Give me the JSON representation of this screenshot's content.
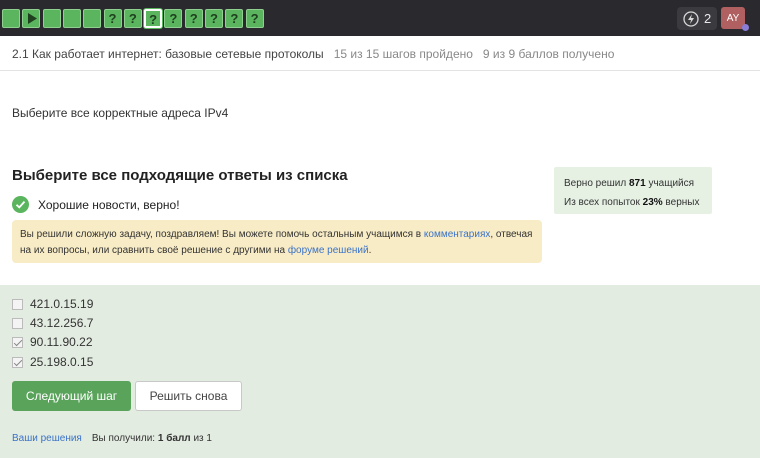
{
  "topbar": {
    "steps": [
      {
        "kind": "square"
      },
      {
        "kind": "play"
      },
      {
        "kind": "square"
      },
      {
        "kind": "square"
      },
      {
        "kind": "square"
      },
      {
        "kind": "question",
        "label": "?"
      },
      {
        "kind": "question",
        "label": "?"
      },
      {
        "kind": "question",
        "label": "?",
        "current": true
      },
      {
        "kind": "question",
        "label": "?"
      },
      {
        "kind": "question",
        "label": "?"
      },
      {
        "kind": "question",
        "label": "?"
      },
      {
        "kind": "question",
        "label": "?"
      },
      {
        "kind": "question",
        "label": "?"
      }
    ],
    "step_color": "#5ab55e",
    "energy_icon": "lightning-icon",
    "energy_count": "2",
    "avatar_initials": "AY"
  },
  "lesson": {
    "title": "2.1 Как работает интернет: базовые сетевые протоколы",
    "steps_done": "15 из 15 шагов пройдено",
    "points": "9 из 9 баллов  получено"
  },
  "question": "Выберите все корректные адреса IPv4",
  "task": {
    "title": "Выберите все подходящие ответы из списка",
    "success_icon": "check-circle-icon",
    "success_text": "Хорошие новости, верно!"
  },
  "hint": {
    "part1": "Вы решили сложную задачу, поздравляем! Вы можете помочь остальным учащимся в ",
    "link1": "комментариях",
    "part2": ", отвечая на их вопросы, или сравнить своё решение с другими на ",
    "link2": "форуме решений",
    "part3": "."
  },
  "stats": {
    "line1_prefix": "Верно решил ",
    "solved_count": "871",
    "line1_suffix": " учащийся",
    "line2_prefix": "Из всех попыток ",
    "percent": "23%",
    "line2_suffix": " верных"
  },
  "options": [
    {
      "label": "421.0.15.19",
      "checked": false
    },
    {
      "label": "43.12.256.7",
      "checked": false
    },
    {
      "label": "90.11.90.22",
      "checked": true
    },
    {
      "label": "25.198.0.15",
      "checked": true
    }
  ],
  "buttons": {
    "next": "Следующий шаг",
    "retry": "Решить снова"
  },
  "footer": {
    "solutions_link": "Ваши решения",
    "score_prefix": "Вы получили: ",
    "score_bold": "1 балл",
    "score_suffix": " из 1"
  },
  "colors": {
    "accent_green": "#5aa35b",
    "hint_bg": "#f8ecc6",
    "answers_bg": "#e3ece1",
    "link": "#3a72c8"
  }
}
